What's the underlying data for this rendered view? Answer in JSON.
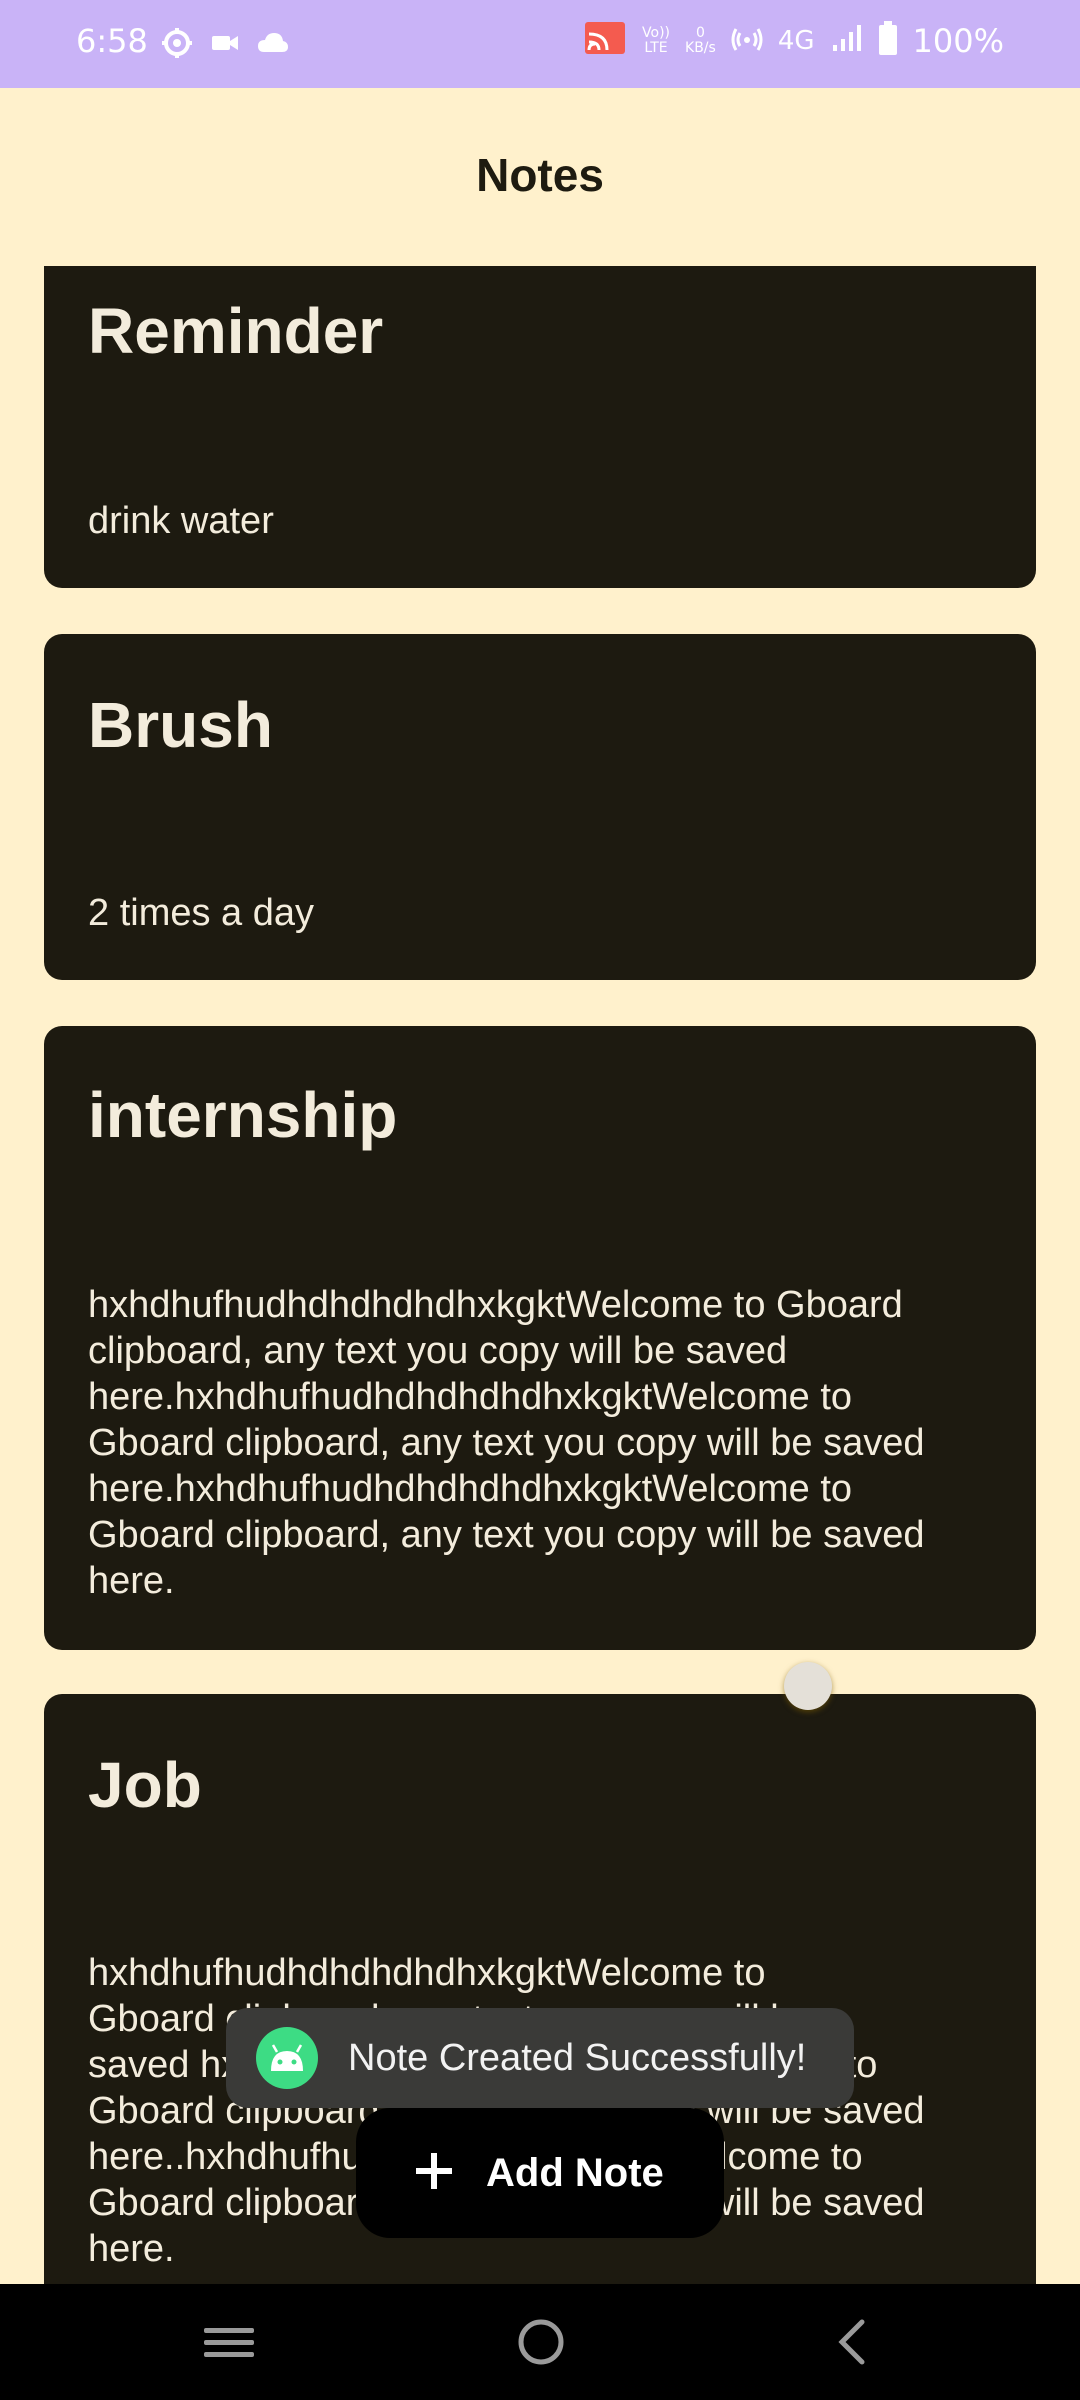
{
  "status_bar": {
    "time": "6:58",
    "volte": "Vo)) LTE",
    "kbs_value": "0",
    "kbs_unit": "KB/s",
    "network": "4G",
    "battery": "100%"
  },
  "header": {
    "title": "Notes"
  },
  "notes": [
    {
      "title": "Reminder",
      "body": "drink water"
    },
    {
      "title": "Brush",
      "body": "2 times a day"
    },
    {
      "title": "internship",
      "body": "hxhdhufhudhdhdhdhdhxkgktWelcome to Gboard clipboard, any text you copy will be saved here.hxhdhufhudhdhdhdhdhxkgktWelcome to Gboard clipboard, any text you copy will be saved here.hxhdhufhudhdhdhdhdhxkgktWelcome to Gboard clipboard, any text you copy will be saved here."
    },
    {
      "title": "Job",
      "body_lines": [
        "hxhdhufhudhdhdhdhdhxkgktWelcome to",
        "Gboard clipboard, any text you copy will be",
        "saved hxhdhufhudhdhdhdhdhxkgktWelcome to",
        "Gboard clipboard, any text you copy will be saved",
        "here..hxhdhufhudhdhdhdhdhxkgktWelcome to",
        "Gboard clipboard, any text you copy will be saved",
        "here."
      ]
    }
  ],
  "toast": {
    "message": "Note Created Successfully!"
  },
  "fab": {
    "label": "Add Note"
  },
  "icons": {
    "toast": "android-icon",
    "fab": "plus-icon",
    "nav": [
      "menu-icon",
      "home-icon",
      "back-icon"
    ]
  },
  "colors": {
    "status_bar": "#c9b3f7",
    "background": "#fff1cc",
    "card": "#1d1a10",
    "fab": "#000000",
    "toast": "#3a3a38"
  }
}
